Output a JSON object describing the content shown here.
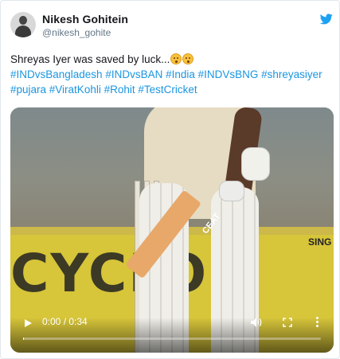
{
  "tweet": {
    "author_name": "Nikesh Gohitein",
    "author_handle": "@nikesh_gohite",
    "text_line1": "Shreyas Iyer was saved by luck...",
    "emoji": [
      "flushed-face-emoji",
      "flushed-face-emoji"
    ],
    "hashtags_line2": "#INDvsBangladesh #INDvsBAN #India #INDVsBNG #shreyasiyer",
    "hashtags_line3": "#pujara #ViratKohli #Rohit #TestCricket"
  },
  "video": {
    "time": "0:00 / 0:34",
    "progress": 0.0,
    "controls": {
      "play_icon": "play-icon",
      "volume_icon": "volume-icon",
      "fullscreen_icon": "fullscreen-icon",
      "more_icon": "more-options-icon"
    },
    "scene_text": {
      "bat_brand": "CEAT",
      "sign_text": "CYCLO",
      "sign_small": "SING"
    }
  },
  "colors": {
    "link": "#1b95e0",
    "twitter_blue": "#1da1f2",
    "handle_gray": "#657786"
  }
}
